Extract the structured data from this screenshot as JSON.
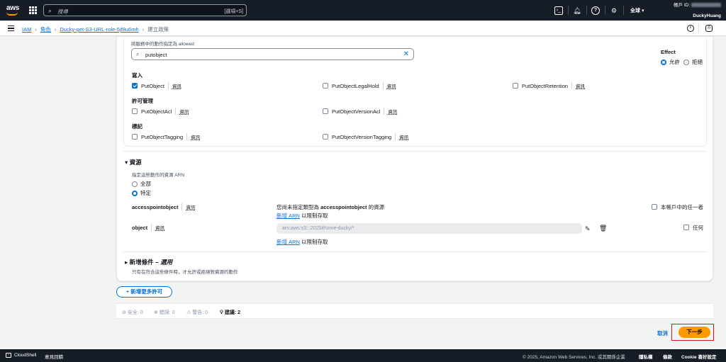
{
  "topbar": {
    "logo": "aws",
    "search_placeholder": "搜尋",
    "search_shortcut": "[選項+S]",
    "region": "全球 ▾",
    "account_prefix": "帳戶 ID:",
    "account_name": "DuckyHuang"
  },
  "breadcrumb": {
    "items": [
      "IAM",
      "角色",
      "Ducky-get-S3-URL-role-5jf8u6mh"
    ],
    "current": "建立政策"
  },
  "actions": {
    "allowed_label": "將服務中的動作指定為 allowed",
    "filter_value": "putobject",
    "groups": [
      {
        "title": "寫入",
        "items": [
          {
            "label": "PutObject",
            "checked": true
          },
          {
            "label": "PutObjectLegalHold",
            "checked": false
          },
          {
            "label": "PutObjectRetention",
            "checked": false
          }
        ]
      },
      {
        "title": "許可管理",
        "items": [
          {
            "label": "PutObjectAcl",
            "checked": false
          },
          {
            "label": "PutObjectVersionAcl",
            "checked": false
          }
        ]
      },
      {
        "title": "標記",
        "items": [
          {
            "label": "PutObjectTagging",
            "checked": false
          },
          {
            "label": "PutObjectVersionTagging",
            "checked": false
          }
        ]
      }
    ],
    "info_label": "資訊"
  },
  "effect": {
    "title": "Effect",
    "allow": "允許",
    "deny": "拒絕",
    "selected": "allow"
  },
  "resources": {
    "title": "資源",
    "arn_label": "指定這些動作的資源 ARN",
    "all_option": "全部",
    "specific_option": "特定",
    "selected": "specific",
    "accesspointobject": {
      "label": "accesspointobject",
      "desc_prefix": "您尚未指定類型為",
      "desc_type": "accesspointobject",
      "desc_suffix": "的資源",
      "add_arn": "新增 ARN",
      "add_arn_suffix": "以限制存取",
      "any_in_account": "本帳戶中的任一者"
    },
    "object": {
      "label": "object",
      "arn_value": "arn:aws:s3:::2025ithome-ducky/*",
      "add_arn": "新增 ARN",
      "add_arn_suffix": "以限制存取",
      "any": "任何"
    }
  },
  "conditions": {
    "title": "新增條件",
    "optional": "– 選用",
    "desc": "只有在符合這些條件時，才允許或拒絕對資源的動作"
  },
  "add_more_permissions": "+ 新增更多許可",
  "validation": {
    "security": "安全: 0",
    "errors": "錯誤: 0",
    "warnings": "警告: 0",
    "suggestions": "建議: 2"
  },
  "buttons": {
    "cancel": "取消",
    "next": "下一步"
  },
  "footer": {
    "cloudshell": "CloudShell",
    "feedback": "意見回饋",
    "copyright": "© 2025, Amazon Web Services, Inc. 或其關係企業",
    "privacy": "隱私權",
    "terms": "條款",
    "cookie": "Cookie 喜好設定"
  },
  "colors": {
    "primary": "#0972d3",
    "topbar": "#161d26",
    "accent": "#ff9900",
    "highlight": "#d91515"
  }
}
